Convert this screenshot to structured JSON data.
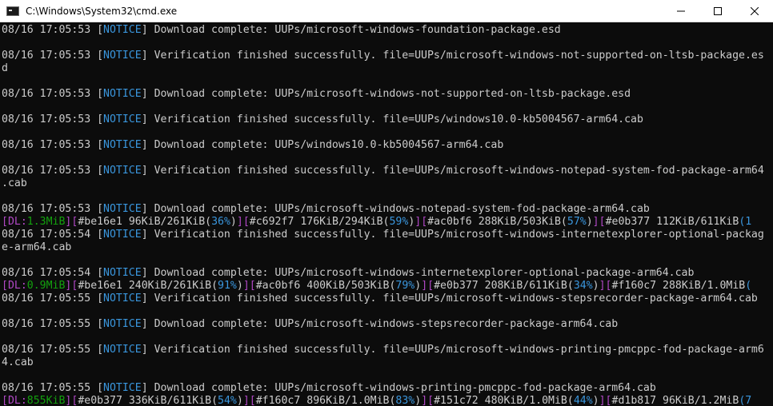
{
  "window": {
    "title": "C:\\Windows\\System32\\cmd.exe",
    "icon": "console-icon",
    "controls": [
      "minimize",
      "maximize",
      "close"
    ]
  },
  "colors": {
    "background": "#0c0c0c",
    "text": "#cccccc",
    "notice": "#3a96dd",
    "dl_bracket": "#b148c6",
    "speed": "#13a10e"
  },
  "lines": [
    {
      "type": "log",
      "ts": "08/16 17:05:53",
      "tag": "NOTICE",
      "msg": "Download complete: UUPs/microsoft-windows-foundation-package.esd"
    },
    {
      "type": "blank"
    },
    {
      "type": "log",
      "ts": "08/16 17:05:53",
      "tag": "NOTICE",
      "msg": "Verification finished successfully. file=UUPs/microsoft-windows-not-supported-on-ltsb-package.es"
    },
    {
      "type": "text",
      "text": "d"
    },
    {
      "type": "blank"
    },
    {
      "type": "log",
      "ts": "08/16 17:05:53",
      "tag": "NOTICE",
      "msg": "Download complete: UUPs/microsoft-windows-not-supported-on-ltsb-package.esd"
    },
    {
      "type": "blank"
    },
    {
      "type": "log",
      "ts": "08/16 17:05:53",
      "tag": "NOTICE",
      "msg": "Verification finished successfully. file=UUPs/windows10.0-kb5004567-arm64.cab"
    },
    {
      "type": "blank"
    },
    {
      "type": "log",
      "ts": "08/16 17:05:53",
      "tag": "NOTICE",
      "msg": "Download complete: UUPs/windows10.0-kb5004567-arm64.cab"
    },
    {
      "type": "blank"
    },
    {
      "type": "log",
      "ts": "08/16 17:05:53",
      "tag": "NOTICE",
      "msg": "Verification finished successfully. file=UUPs/microsoft-windows-notepad-system-fod-package-arm64"
    },
    {
      "type": "text",
      "text": ".cab"
    },
    {
      "type": "blank"
    },
    {
      "type": "log",
      "ts": "08/16 17:05:53",
      "tag": "NOTICE",
      "msg": "Download complete: UUPs/microsoft-windows-notepad-system-fod-package-arm64.cab"
    },
    {
      "type": "progress",
      "speed": "1.3MiB",
      "items": [
        {
          "id": "#be16e1",
          "size": "96KiB/261KiB",
          "pct": "36%",
          "tail": "]"
        },
        {
          "id": "#c692f7",
          "size": "176KiB/294KiB",
          "pct": "59%",
          "tail": "]"
        },
        {
          "id": "#ac0bf6",
          "size": "288KiB/503KiB",
          "pct": "57%",
          "tail": "]"
        },
        {
          "id": "#e0b377",
          "size": "112KiB/611KiB",
          "pct": "(1",
          "tail": ""
        }
      ]
    },
    {
      "type": "log",
      "ts": "08/16 17:05:54",
      "tag": "NOTICE",
      "msg": "Verification finished successfully. file=UUPs/microsoft-windows-internetexplorer-optional-packag"
    },
    {
      "type": "text",
      "text": "e-arm64.cab"
    },
    {
      "type": "blank"
    },
    {
      "type": "log",
      "ts": "08/16 17:05:54",
      "tag": "NOTICE",
      "msg": "Download complete: UUPs/microsoft-windows-internetexplorer-optional-package-arm64.cab"
    },
    {
      "type": "progress",
      "speed": "0.9MiB",
      "items": [
        {
          "id": "#be16e1",
          "size": "240KiB/261KiB",
          "pct": "91%",
          "tail": "]"
        },
        {
          "id": "#ac0bf6",
          "size": "400KiB/503KiB",
          "pct": "79%",
          "tail": "]"
        },
        {
          "id": "#e0b377",
          "size": "208KiB/611KiB",
          "pct": "34%",
          "tail": "]"
        },
        {
          "id": "#f160c7",
          "size": "288KiB/1.0MiB",
          "pct": "(",
          "tail": ""
        }
      ]
    },
    {
      "type": "log",
      "ts": "08/16 17:05:55",
      "tag": "NOTICE",
      "msg": "Verification finished successfully. file=UUPs/microsoft-windows-stepsrecorder-package-arm64.cab"
    },
    {
      "type": "blank"
    },
    {
      "type": "log",
      "ts": "08/16 17:05:55",
      "tag": "NOTICE",
      "msg": "Download complete: UUPs/microsoft-windows-stepsrecorder-package-arm64.cab"
    },
    {
      "type": "blank"
    },
    {
      "type": "log",
      "ts": "08/16 17:05:55",
      "tag": "NOTICE",
      "msg": "Verification finished successfully. file=UUPs/microsoft-windows-printing-pmcppc-fod-package-arm6"
    },
    {
      "type": "text",
      "text": "4.cab"
    },
    {
      "type": "blank"
    },
    {
      "type": "log",
      "ts": "08/16 17:05:55",
      "tag": "NOTICE",
      "msg": "Download complete: UUPs/microsoft-windows-printing-pmcppc-fod-package-arm64.cab"
    },
    {
      "type": "progress",
      "speed": "855KiB",
      "items": [
        {
          "id": "#e0b377",
          "size": "336KiB/611KiB",
          "pct": "54%",
          "tail": "]"
        },
        {
          "id": "#f160c7",
          "size": "896KiB/1.0MiB",
          "pct": "83%",
          "tail": "]"
        },
        {
          "id": "#151c72",
          "size": "480KiB/1.0MiB",
          "pct": "44%",
          "tail": "]"
        },
        {
          "id": "#d1b817",
          "size": "96KiB/1.2MiB",
          "pct": "(7",
          "tail": ""
        }
      ]
    }
  ]
}
